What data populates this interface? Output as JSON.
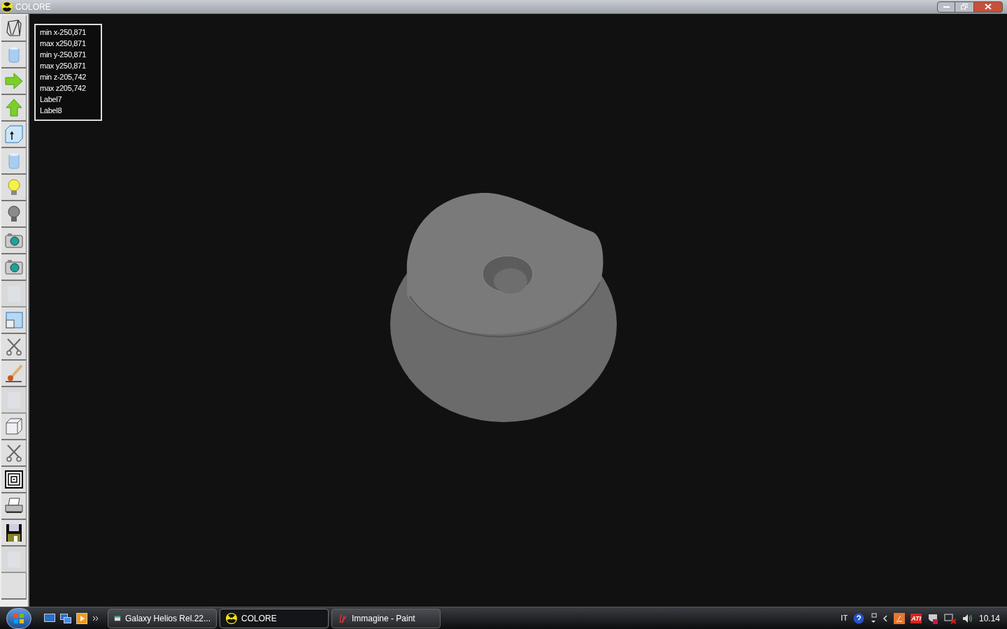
{
  "window": {
    "title": "COLORE"
  },
  "toolbar": [
    {
      "kind": "wireframe",
      "disabled": false
    },
    {
      "kind": "cylinder",
      "disabled": false
    },
    {
      "kind": "arrow-right",
      "disabled": false
    },
    {
      "kind": "arrow-up",
      "disabled": false
    },
    {
      "kind": "box-arrow",
      "disabled": false
    },
    {
      "kind": "cylinder",
      "disabled": false
    },
    {
      "kind": "light-on",
      "disabled": false
    },
    {
      "kind": "light-off",
      "disabled": false
    },
    {
      "kind": "camera",
      "disabled": false
    },
    {
      "kind": "camera",
      "disabled": false
    },
    {
      "kind": "texture",
      "disabled": true
    },
    {
      "kind": "window",
      "disabled": false
    },
    {
      "kind": "scissors",
      "disabled": false
    },
    {
      "kind": "brush",
      "disabled": false
    },
    {
      "kind": "texture",
      "disabled": true
    },
    {
      "kind": "cube",
      "disabled": false
    },
    {
      "kind": "scissors",
      "disabled": false
    },
    {
      "kind": "target",
      "disabled": false
    },
    {
      "kind": "printer",
      "disabled": false
    },
    {
      "kind": "floppy",
      "disabled": false
    },
    {
      "kind": "texture",
      "disabled": true
    },
    {
      "kind": "blank",
      "disabled": false
    }
  ],
  "info_panel": [
    "min x-250,871",
    "max x250,871",
    "min y-250,871",
    "max y250,871",
    "min z-205,742",
    "max z205,742",
    "Label7",
    "Label8"
  ],
  "taskbar": {
    "buttons": [
      {
        "label": "Galaxy Helios  Rel.22...",
        "kind": "app",
        "selected": false
      },
      {
        "label": "COLORE",
        "kind": "radiation",
        "selected": true
      },
      {
        "label": "Immagine - Paint",
        "kind": "paint",
        "selected": false
      }
    ],
    "language": "IT",
    "tray_badge": "ATI",
    "clock": "10.14"
  }
}
